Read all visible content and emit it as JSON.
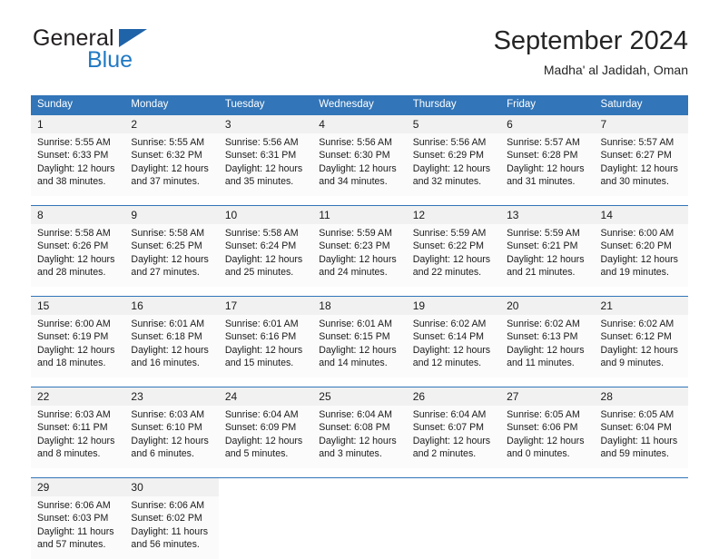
{
  "brand": {
    "name_top": "General",
    "name_bottom": "Blue",
    "triangle_color": "#1f63a8",
    "blue_color": "#2079c4"
  },
  "header": {
    "title": "September 2024",
    "subtitle": "Madha' al Jadidah, Oman"
  },
  "theme": {
    "header_blue": "#3275b8",
    "daynum_band": "#f1f1f1",
    "cell_bg": "#fbfbfb"
  },
  "calendar": {
    "weekday_headers": [
      "Sunday",
      "Monday",
      "Tuesday",
      "Wednesday",
      "Thursday",
      "Friday",
      "Saturday"
    ],
    "weeks": [
      [
        {
          "day": "1",
          "sunrise": "Sunrise: 5:55 AM",
          "sunset": "Sunset: 6:33 PM",
          "daylight_1": "Daylight: 12 hours",
          "daylight_2": "and 38 minutes."
        },
        {
          "day": "2",
          "sunrise": "Sunrise: 5:55 AM",
          "sunset": "Sunset: 6:32 PM",
          "daylight_1": "Daylight: 12 hours",
          "daylight_2": "and 37 minutes."
        },
        {
          "day": "3",
          "sunrise": "Sunrise: 5:56 AM",
          "sunset": "Sunset: 6:31 PM",
          "daylight_1": "Daylight: 12 hours",
          "daylight_2": "and 35 minutes."
        },
        {
          "day": "4",
          "sunrise": "Sunrise: 5:56 AM",
          "sunset": "Sunset: 6:30 PM",
          "daylight_1": "Daylight: 12 hours",
          "daylight_2": "and 34 minutes."
        },
        {
          "day": "5",
          "sunrise": "Sunrise: 5:56 AM",
          "sunset": "Sunset: 6:29 PM",
          "daylight_1": "Daylight: 12 hours",
          "daylight_2": "and 32 minutes."
        },
        {
          "day": "6",
          "sunrise": "Sunrise: 5:57 AM",
          "sunset": "Sunset: 6:28 PM",
          "daylight_1": "Daylight: 12 hours",
          "daylight_2": "and 31 minutes."
        },
        {
          "day": "7",
          "sunrise": "Sunrise: 5:57 AM",
          "sunset": "Sunset: 6:27 PM",
          "daylight_1": "Daylight: 12 hours",
          "daylight_2": "and 30 minutes."
        }
      ],
      [
        {
          "day": "8",
          "sunrise": "Sunrise: 5:58 AM",
          "sunset": "Sunset: 6:26 PM",
          "daylight_1": "Daylight: 12 hours",
          "daylight_2": "and 28 minutes."
        },
        {
          "day": "9",
          "sunrise": "Sunrise: 5:58 AM",
          "sunset": "Sunset: 6:25 PM",
          "daylight_1": "Daylight: 12 hours",
          "daylight_2": "and 27 minutes."
        },
        {
          "day": "10",
          "sunrise": "Sunrise: 5:58 AM",
          "sunset": "Sunset: 6:24 PM",
          "daylight_1": "Daylight: 12 hours",
          "daylight_2": "and 25 minutes."
        },
        {
          "day": "11",
          "sunrise": "Sunrise: 5:59 AM",
          "sunset": "Sunset: 6:23 PM",
          "daylight_1": "Daylight: 12 hours",
          "daylight_2": "and 24 minutes."
        },
        {
          "day": "12",
          "sunrise": "Sunrise: 5:59 AM",
          "sunset": "Sunset: 6:22 PM",
          "daylight_1": "Daylight: 12 hours",
          "daylight_2": "and 22 minutes."
        },
        {
          "day": "13",
          "sunrise": "Sunrise: 5:59 AM",
          "sunset": "Sunset: 6:21 PM",
          "daylight_1": "Daylight: 12 hours",
          "daylight_2": "and 21 minutes."
        },
        {
          "day": "14",
          "sunrise": "Sunrise: 6:00 AM",
          "sunset": "Sunset: 6:20 PM",
          "daylight_1": "Daylight: 12 hours",
          "daylight_2": "and 19 minutes."
        }
      ],
      [
        {
          "day": "15",
          "sunrise": "Sunrise: 6:00 AM",
          "sunset": "Sunset: 6:19 PM",
          "daylight_1": "Daylight: 12 hours",
          "daylight_2": "and 18 minutes."
        },
        {
          "day": "16",
          "sunrise": "Sunrise: 6:01 AM",
          "sunset": "Sunset: 6:18 PM",
          "daylight_1": "Daylight: 12 hours",
          "daylight_2": "and 16 minutes."
        },
        {
          "day": "17",
          "sunrise": "Sunrise: 6:01 AM",
          "sunset": "Sunset: 6:16 PM",
          "daylight_1": "Daylight: 12 hours",
          "daylight_2": "and 15 minutes."
        },
        {
          "day": "18",
          "sunrise": "Sunrise: 6:01 AM",
          "sunset": "Sunset: 6:15 PM",
          "daylight_1": "Daylight: 12 hours",
          "daylight_2": "and 14 minutes."
        },
        {
          "day": "19",
          "sunrise": "Sunrise: 6:02 AM",
          "sunset": "Sunset: 6:14 PM",
          "daylight_1": "Daylight: 12 hours",
          "daylight_2": "and 12 minutes."
        },
        {
          "day": "20",
          "sunrise": "Sunrise: 6:02 AM",
          "sunset": "Sunset: 6:13 PM",
          "daylight_1": "Daylight: 12 hours",
          "daylight_2": "and 11 minutes."
        },
        {
          "day": "21",
          "sunrise": "Sunrise: 6:02 AM",
          "sunset": "Sunset: 6:12 PM",
          "daylight_1": "Daylight: 12 hours",
          "daylight_2": "and 9 minutes."
        }
      ],
      [
        {
          "day": "22",
          "sunrise": "Sunrise: 6:03 AM",
          "sunset": "Sunset: 6:11 PM",
          "daylight_1": "Daylight: 12 hours",
          "daylight_2": "and 8 minutes."
        },
        {
          "day": "23",
          "sunrise": "Sunrise: 6:03 AM",
          "sunset": "Sunset: 6:10 PM",
          "daylight_1": "Daylight: 12 hours",
          "daylight_2": "and 6 minutes."
        },
        {
          "day": "24",
          "sunrise": "Sunrise: 6:04 AM",
          "sunset": "Sunset: 6:09 PM",
          "daylight_1": "Daylight: 12 hours",
          "daylight_2": "and 5 minutes."
        },
        {
          "day": "25",
          "sunrise": "Sunrise: 6:04 AM",
          "sunset": "Sunset: 6:08 PM",
          "daylight_1": "Daylight: 12 hours",
          "daylight_2": "and 3 minutes."
        },
        {
          "day": "26",
          "sunrise": "Sunrise: 6:04 AM",
          "sunset": "Sunset: 6:07 PM",
          "daylight_1": "Daylight: 12 hours",
          "daylight_2": "and 2 minutes."
        },
        {
          "day": "27",
          "sunrise": "Sunrise: 6:05 AM",
          "sunset": "Sunset: 6:06 PM",
          "daylight_1": "Daylight: 12 hours",
          "daylight_2": "and 0 minutes."
        },
        {
          "day": "28",
          "sunrise": "Sunrise: 6:05 AM",
          "sunset": "Sunset: 6:04 PM",
          "daylight_1": "Daylight: 11 hours",
          "daylight_2": "and 59 minutes."
        }
      ],
      [
        {
          "day": "29",
          "sunrise": "Sunrise: 6:06 AM",
          "sunset": "Sunset: 6:03 PM",
          "daylight_1": "Daylight: 11 hours",
          "daylight_2": "and 57 minutes."
        },
        {
          "day": "30",
          "sunrise": "Sunrise: 6:06 AM",
          "sunset": "Sunset: 6:02 PM",
          "daylight_1": "Daylight: 11 hours",
          "daylight_2": "and 56 minutes."
        },
        {
          "day": "",
          "sunrise": "",
          "sunset": "",
          "daylight_1": "",
          "daylight_2": ""
        },
        {
          "day": "",
          "sunrise": "",
          "sunset": "",
          "daylight_1": "",
          "daylight_2": ""
        },
        {
          "day": "",
          "sunrise": "",
          "sunset": "",
          "daylight_1": "",
          "daylight_2": ""
        },
        {
          "day": "",
          "sunrise": "",
          "sunset": "",
          "daylight_1": "",
          "daylight_2": ""
        },
        {
          "day": "",
          "sunrise": "",
          "sunset": "",
          "daylight_1": "",
          "daylight_2": ""
        }
      ]
    ]
  }
}
